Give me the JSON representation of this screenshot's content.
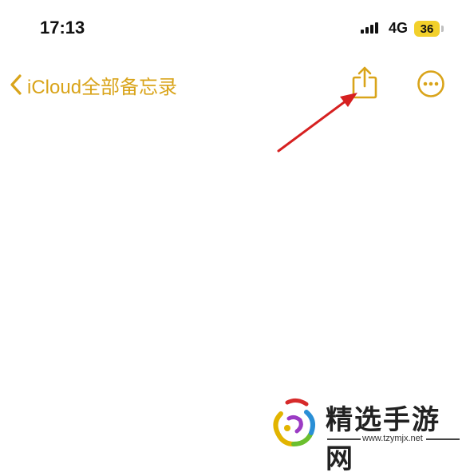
{
  "status_bar": {
    "time": "17:13",
    "network": "4G",
    "battery": "36"
  },
  "nav": {
    "back_label": "iCloud全部备忘录",
    "accent_color": "#d9a41a",
    "icons": [
      "chevron-left-icon",
      "share-icon",
      "more-icon"
    ]
  },
  "annotation": {
    "arrow_color": "#d62020"
  },
  "watermark": {
    "title": "精选手游网",
    "url": "www.tzymjx.net"
  }
}
